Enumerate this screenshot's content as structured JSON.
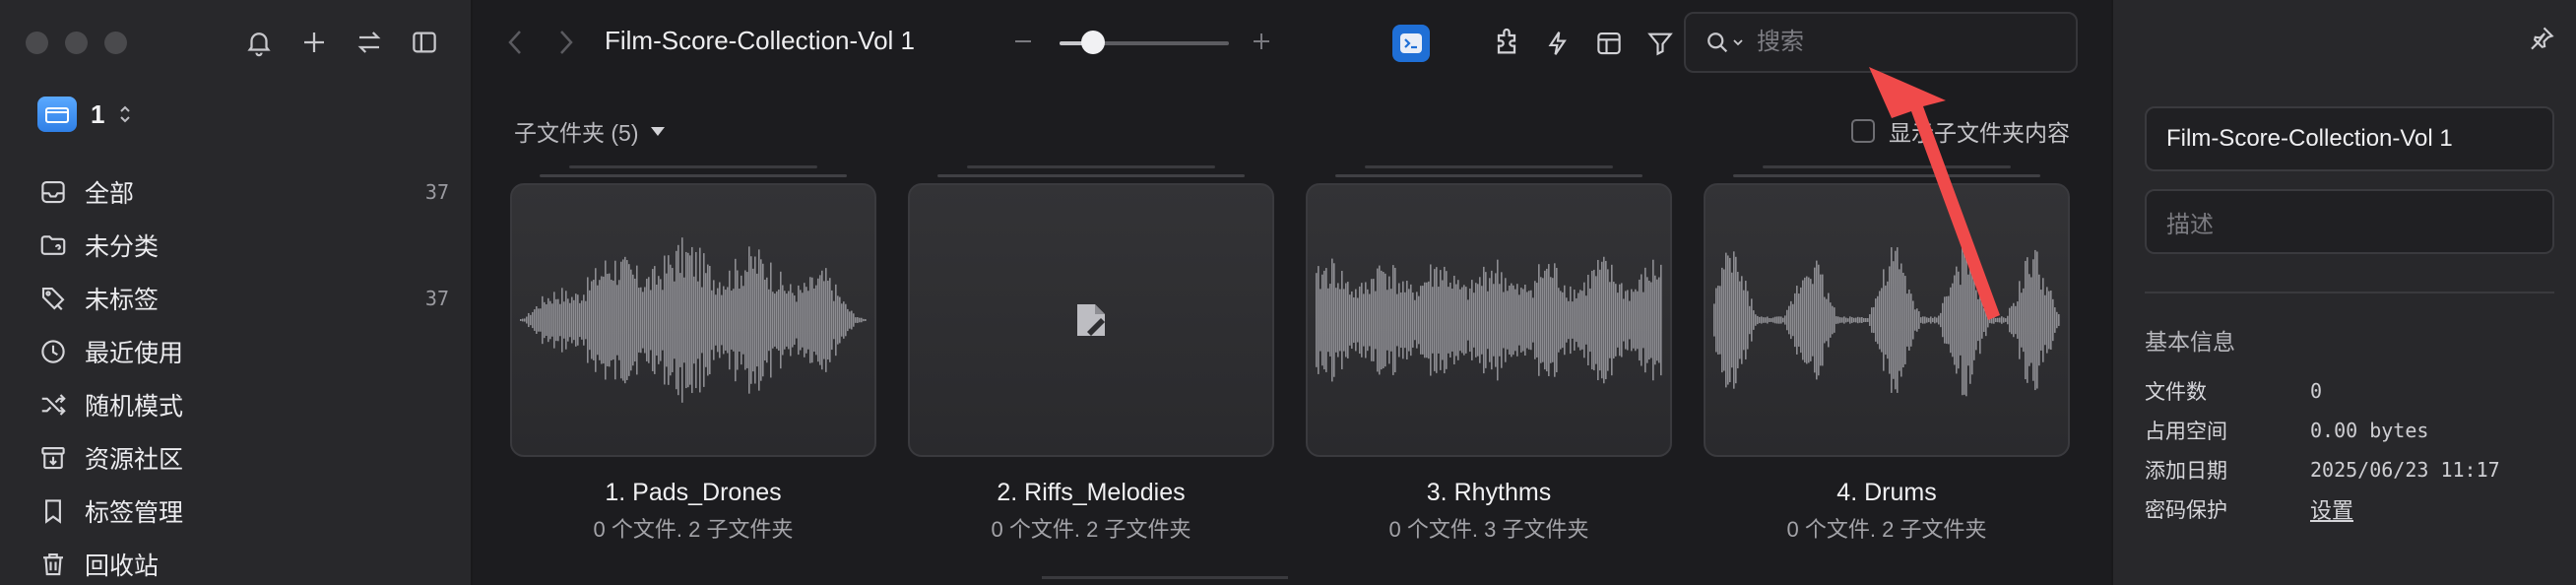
{
  "sidebar": {
    "library_name": "1",
    "items": [
      {
        "label": "全部",
        "count": "37",
        "icon": "inbox-icon"
      },
      {
        "label": "未分类",
        "count": "",
        "icon": "folder-question-icon"
      },
      {
        "label": "未标签",
        "count": "37",
        "icon": "tag-slash-icon"
      },
      {
        "label": "最近使用",
        "count": "",
        "icon": "clock-icon"
      },
      {
        "label": "随机模式",
        "count": "",
        "icon": "shuffle-icon"
      },
      {
        "label": "资源社区",
        "count": "",
        "icon": "archive-icon"
      },
      {
        "label": "标签管理",
        "count": "",
        "icon": "bookmark-icon"
      },
      {
        "label": "回收站",
        "count": "",
        "icon": "trash-icon"
      }
    ]
  },
  "toolbar": {
    "title": "Film-Score-Collection-Vol 1",
    "zoom_level": 0.2,
    "search_placeholder": "搜索"
  },
  "subbar": {
    "subfolders_label": "子文件夹 (5)",
    "show_subfolder_content_label": "显示子文件夹内容"
  },
  "folders": [
    {
      "name": "1. Pads_Drones",
      "meta": "0 个文件. 2 子文件夹",
      "thumb": "waveform-pads"
    },
    {
      "name": "2. Riffs_Melodies",
      "meta": "0 个文件. 2 子文件夹",
      "thumb": "file-placeholder"
    },
    {
      "name": "3. Rhythms",
      "meta": "0 个文件. 3 子文件夹",
      "thumb": "waveform-rhythms"
    },
    {
      "name": "4. Drums",
      "meta": "0 个文件. 2 子文件夹",
      "thumb": "waveform-drums"
    }
  ],
  "inspector": {
    "name_value": "Film-Score-Collection-Vol 1",
    "description_placeholder": "描述",
    "section_title": "基本信息",
    "rows": [
      {
        "key": "文件数",
        "value": "0"
      },
      {
        "key": "占用空间",
        "value": "0.00 bytes"
      },
      {
        "key": "添加日期",
        "value": "2025/06/23 11:17"
      },
      {
        "key": "密码保护",
        "value": "设置"
      }
    ]
  },
  "colors": {
    "accent": "#1f6fd6",
    "annotation_arrow": "#f04a4a",
    "background": "#1c1c1f",
    "panel": "#28282b"
  }
}
